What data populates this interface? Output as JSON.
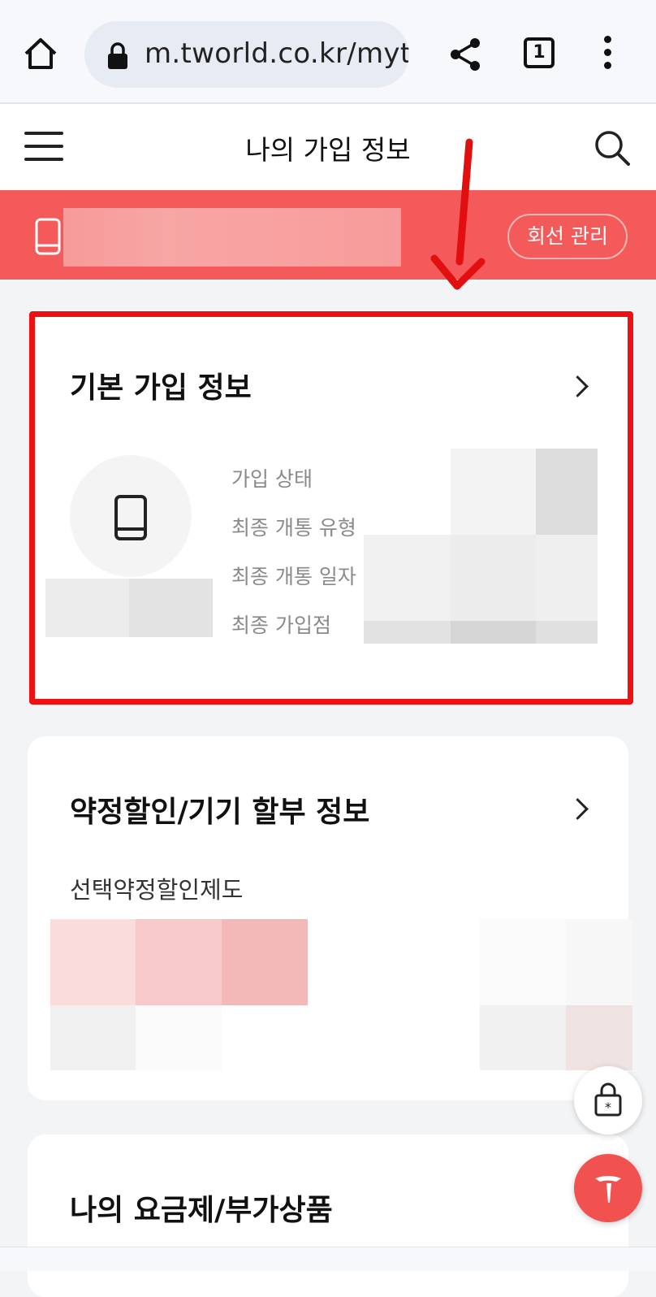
{
  "browser": {
    "url": "m.tworld.co.kr/myt",
    "tab_count": "1"
  },
  "header": {
    "title": "나의 가입 정보"
  },
  "line": {
    "manage_label": "회선 관리"
  },
  "basic_info": {
    "title": "기본 가입 정보",
    "labels": [
      "가입 상태",
      "최종 개통 유형",
      "최종 개통 일자",
      "최종 가입점"
    ]
  },
  "contract": {
    "title": "약정할인/기기 할부 정보",
    "subtitle": "선택약정할인제도"
  },
  "plan": {
    "title": "나의 요금제/부가상품"
  },
  "colors": {
    "accent": "#f45a59",
    "highlight": "#ef1111"
  }
}
